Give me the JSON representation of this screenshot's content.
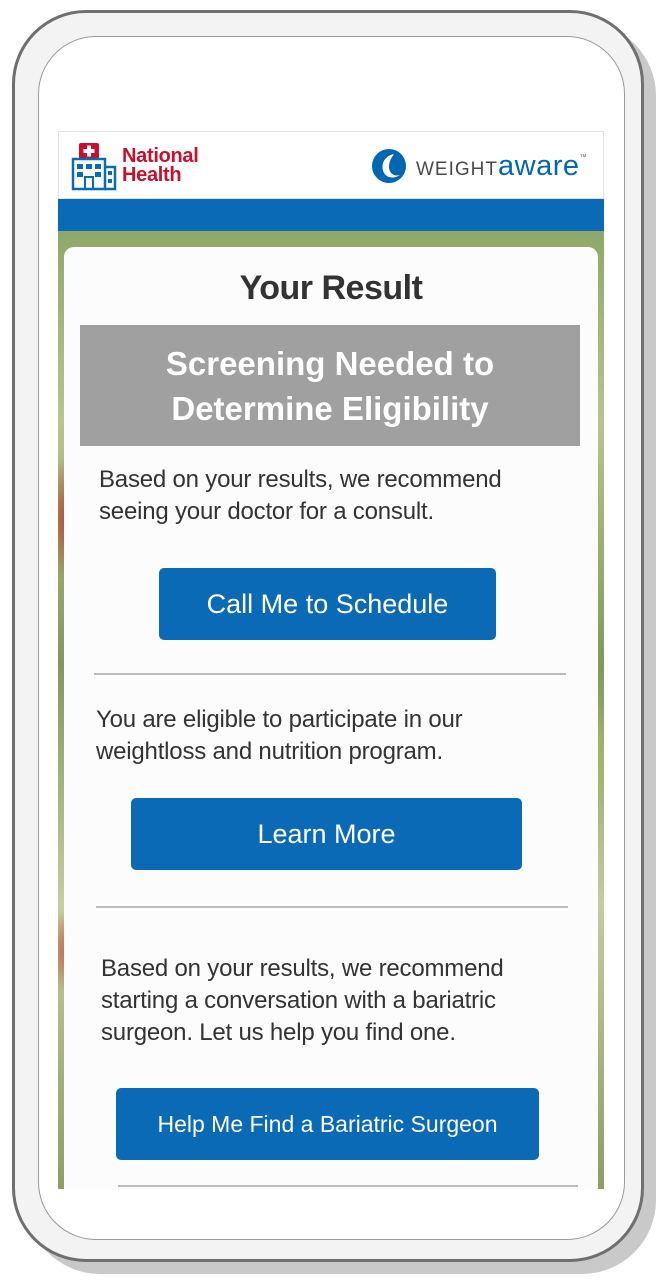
{
  "header": {
    "national_health_line1": "National",
    "national_health_line2": "Health",
    "weightaware_part1": "WEIGHT",
    "weightaware_part2": "aware",
    "weightaware_tm": "™",
    "icons": [
      "hospital-icon",
      "weightaware-swirl-icon"
    ]
  },
  "result": {
    "title": "Your Result",
    "status_line1": "Screening Needed to",
    "status_line2": "Determine Eligibility"
  },
  "sections": [
    {
      "text_line1": "Based on your results, we recommend",
      "text_line2": "seeing your doctor for a consult.",
      "button_label": "Call Me to Schedule"
    },
    {
      "text_line1": "You are eligible to participate in our",
      "text_line2": "weightloss and nutrition program.",
      "button_label": "Learn More"
    },
    {
      "text_line1": "Based on your results, we recommend",
      "text_line2": "starting a conversation with a bariatric",
      "text_line3": "surgeon. Let us help you find one.",
      "button_label": "Help Me Find a Bariatric Surgeon"
    }
  ],
  "colors": {
    "brand_red": "#c8102e",
    "brand_blue": "#0a6ab6",
    "banner_gray": "#a0a0a0"
  }
}
